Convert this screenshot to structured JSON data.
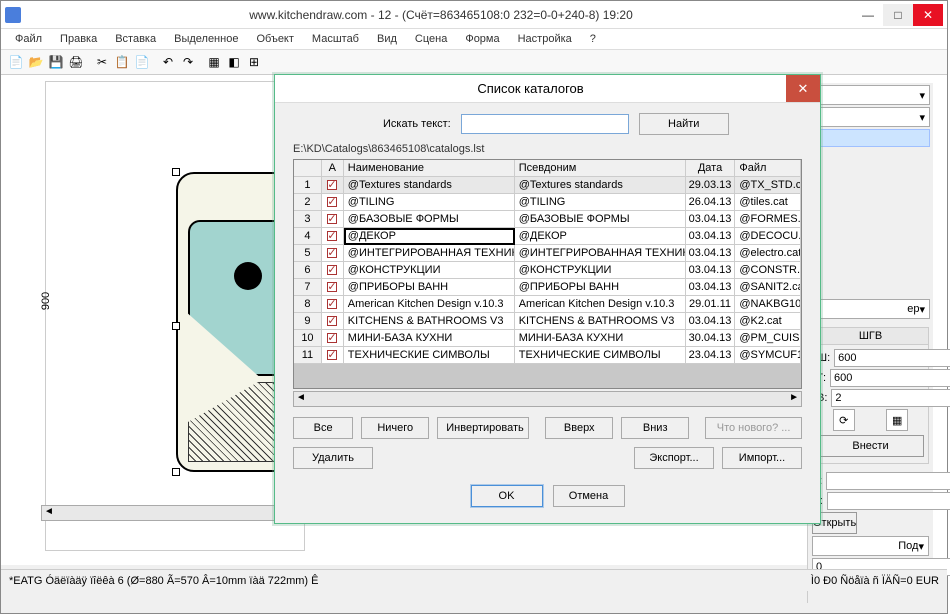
{
  "window": {
    "title": "www.kitchendraw.com - 12 - (Счёт=863465108:0 232=0-0+240-8) 19:20"
  },
  "menu": [
    "Файл",
    "Правка",
    "Вставка",
    "Выделенное",
    "Объект",
    "Масштаб",
    "Вид",
    "Сцена",
    "Форма",
    "Настройка",
    "?"
  ],
  "dimension_v": "900",
  "right": {
    "group_title": "ШГВ",
    "W_label": "Ш:",
    "W": "600",
    "D_label": "Г:",
    "D": "600",
    "H_label": "В:",
    "H": "2",
    "submit": "Внести",
    "L_label": "Л:",
    "L": "",
    "P_label": "П:",
    "P": "",
    "open": "Открыть",
    "under": "Под",
    "zero": "0",
    "er": "ер"
  },
  "dialog": {
    "title": "Список каталогов",
    "search_label": "Искать текст:",
    "search_value": "",
    "find": "Найти",
    "path": "E:\\KD\\Catalogs\\863465108\\catalogs.lst",
    "headers": {
      "a": "А",
      "name": "Наименование",
      "alias": "Псевдоним",
      "date": "Дата",
      "file": "Файл"
    },
    "rows": [
      {
        "n": "1",
        "name": "@Textures standards",
        "alias": "@Textures standards",
        "date": "29.03.13",
        "file": "@TX_STD.c"
      },
      {
        "n": "2",
        "name": "@TILING",
        "alias": "@TILING",
        "date": "26.04.13",
        "file": "@tiles.cat"
      },
      {
        "n": "3",
        "name": "@БАЗОВЫЕ ФОРМЫ",
        "alias": "@БАЗОВЫЕ ФОРМЫ",
        "date": "03.04.13",
        "file": "@FORMES.c"
      },
      {
        "n": "4",
        "name": "@ДЕКОР",
        "alias": "@ДЕКОР",
        "date": "03.04.13",
        "file": "@DECOCU."
      },
      {
        "n": "5",
        "name": "@ИНТЕГРИРОВАННАЯ ТЕХНИКА",
        "alias": "@ИНТЕГРИРОВАННАЯ ТЕХНИКА",
        "date": "03.04.13",
        "file": "@electro.cat"
      },
      {
        "n": "6",
        "name": "@КОНСТРУКЦИИ",
        "alias": "@КОНСТРУКЦИИ",
        "date": "03.04.13",
        "file": "@CONSTR.c"
      },
      {
        "n": "7",
        "name": "@ПРИБОРЫ ВАНН",
        "alias": "@ПРИБОРЫ ВАНН",
        "date": "03.04.13",
        "file": "@SANIT2.ca"
      },
      {
        "n": "8",
        "name": "American Kitchen Design v.10.3",
        "alias": "American Kitchen Design v.10.3",
        "date": "29.01.11",
        "file": "@NAKBG10."
      },
      {
        "n": "9",
        "name": "KITCHENS & BATHROOMS V3",
        "alias": "KITCHENS & BATHROOMS V3",
        "date": "03.04.13",
        "file": "@K2.cat"
      },
      {
        "n": "10",
        "name": "МИНИ-БАЗА КУХНИ",
        "alias": "МИНИ-БАЗА КУХНИ",
        "date": "30.04.13",
        "file": "@PM_CUIS."
      },
      {
        "n": "11",
        "name": "ТЕХНИЧЕСКИЕ СИМВОЛЫ",
        "alias": "ТЕХНИЧЕСКИЕ СИМВОЛЫ",
        "date": "23.04.13",
        "file": "@SYMCUF1."
      }
    ],
    "btn_all": "Все",
    "btn_none": "Ничего",
    "btn_invert": "Инвертировать",
    "btn_up": "Вверх",
    "btn_down": "Вниз",
    "btn_whatsnew": "Что нового? ...",
    "btn_delete": "Удалить",
    "btn_export": "Экспорт...",
    "btn_import": "Импорт...",
    "btn_ok": "OK",
    "btn_cancel": "Отмена"
  },
  "status": {
    "left": "*EATG  Óäëïàäÿ ïîëêà 6  (Ø=880 Ã=570 Â=10mm ïàä 722mm) Ê",
    "right": "Ì0   Ð0 Ñöåïà ñ ÏÄÑ=0 EUR"
  }
}
